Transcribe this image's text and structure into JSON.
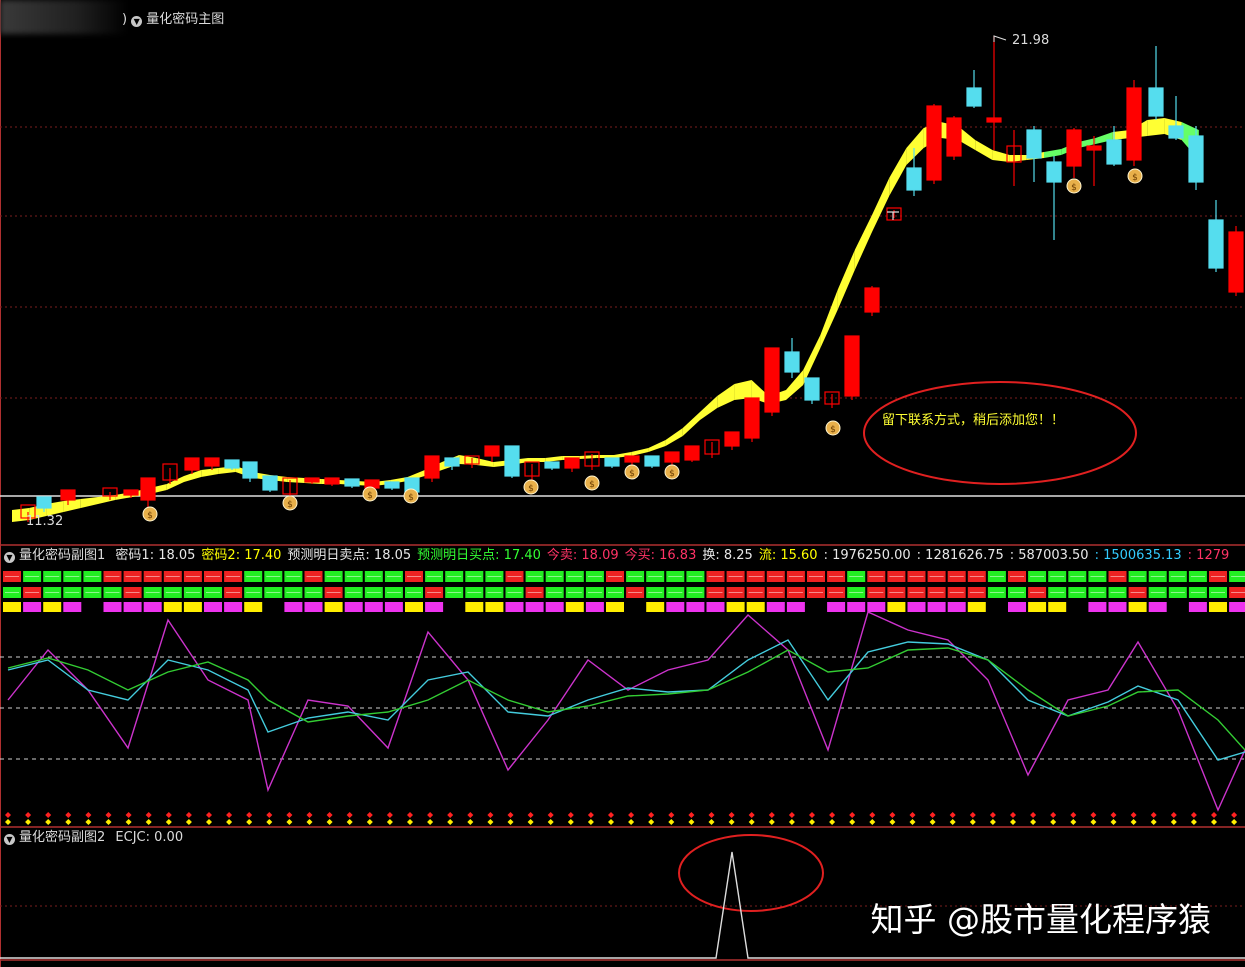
{
  "main_panel": {
    "title": "量化密码主图",
    "title_prefix": ")",
    "high_label": "21.98",
    "low_label": "11.32",
    "note": "留下联系方式，稍后添加您！！"
  },
  "sub1": {
    "title": "量化密码副图1",
    "readouts": [
      {
        "label": "密码1:",
        "value": "18.05",
        "color": "#e8e8e8"
      },
      {
        "label": "密码2:",
        "value": "17.40",
        "color": "#ffff00"
      },
      {
        "label": "预测明日卖点:",
        "value": "18.05",
        "color": "#e8e8e8"
      },
      {
        "label": "预测明日买点:",
        "value": "17.40",
        "color": "#33ff33"
      },
      {
        "label": "今卖:",
        "value": "18.09",
        "color": "#ff3366"
      },
      {
        "label": "今买:",
        "value": "16.83",
        "color": "#ff3366"
      },
      {
        "label": "换:",
        "value": "8.25",
        "color": "#e8e8e8"
      },
      {
        "label": "流:",
        "value": "15.60",
        "color": "#ffff00"
      },
      {
        "label": ":",
        "value": "1976250.00",
        "color": "#e8e8e8"
      },
      {
        "label": ":",
        "value": "1281626.75",
        "color": "#e8e8e8"
      },
      {
        "label": ":",
        "value": "587003.50",
        "color": "#e8e8e8"
      },
      {
        "label": ":",
        "value": "1500635.13",
        "color": "#33ccff"
      },
      {
        "label": ":",
        "value": "1279",
        "color": "#ff3366"
      }
    ]
  },
  "sub2": {
    "title": "量化密码副图2",
    "readout_label": "ECJC:",
    "readout_value": "0.00"
  },
  "watermark": "知乎 @股市量化程序猿",
  "colors": {
    "up": "#ff0000",
    "down": "#55ddee",
    "band_up": "#ffff33",
    "band_down": "#66ff66",
    "line_cyan": "#44ccdd",
    "line_green": "#33cc33",
    "line_purple": "#cc33cc"
  },
  "icons": {
    "money_bag": "money-bag-icon",
    "collapse": "collapse-triangle-icon"
  }
}
